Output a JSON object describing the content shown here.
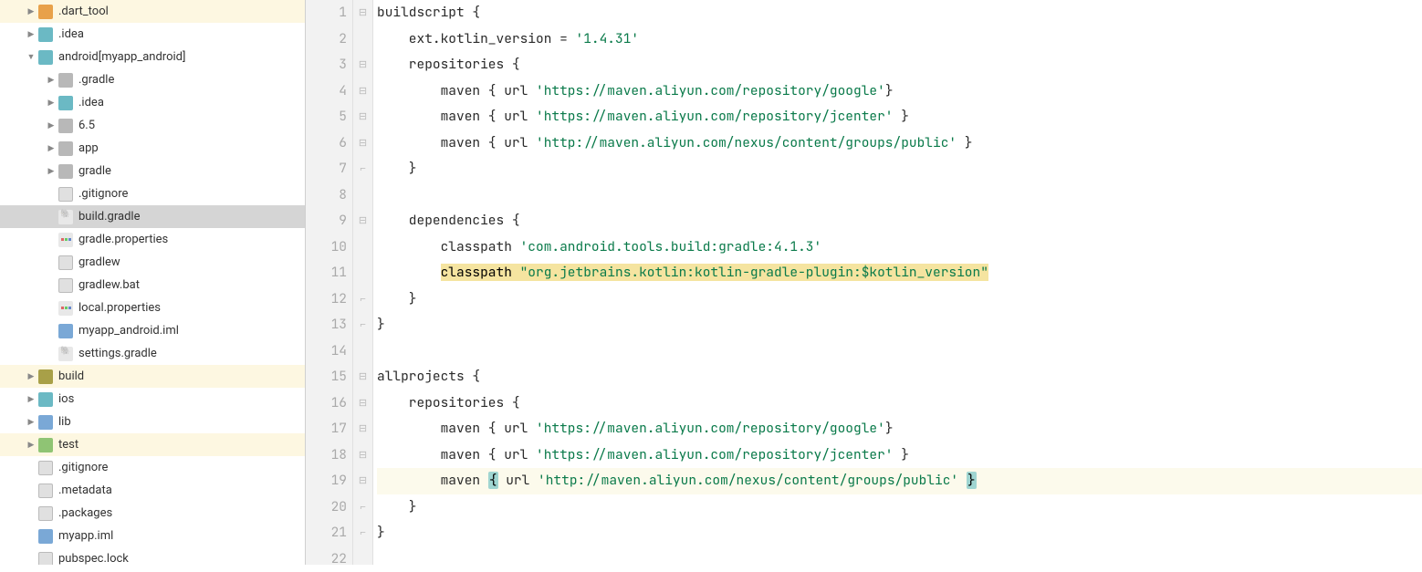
{
  "tree": {
    "items": [
      {
        "depth": 1,
        "arrow": "right",
        "icon": "folder-orange",
        "label": ".dart_tool",
        "hl": "yellow"
      },
      {
        "depth": 1,
        "arrow": "right",
        "icon": "folder-teal",
        "label": ".idea"
      },
      {
        "depth": 1,
        "arrow": "down",
        "icon": "folder-teal",
        "label": "android",
        "suffix": " [myapp_android]",
        "bold_suffix": true
      },
      {
        "depth": 2,
        "arrow": "right",
        "icon": "folder-gray",
        "label": ".gradle"
      },
      {
        "depth": 2,
        "arrow": "right",
        "icon": "folder-teal",
        "label": ".idea"
      },
      {
        "depth": 2,
        "arrow": "right",
        "icon": "folder-gray",
        "label": "6.5"
      },
      {
        "depth": 2,
        "arrow": "right",
        "icon": "folder-gray",
        "label": "app"
      },
      {
        "depth": 2,
        "arrow": "right",
        "icon": "folder-gray",
        "label": "gradle"
      },
      {
        "depth": 2,
        "arrow": "none",
        "icon": "file",
        "label": ".gitignore"
      },
      {
        "depth": 2,
        "arrow": "none",
        "icon": "gradle",
        "label": "build.gradle",
        "selected": true
      },
      {
        "depth": 2,
        "arrow": "none",
        "icon": "prop",
        "label": "gradle.properties"
      },
      {
        "depth": 2,
        "arrow": "none",
        "icon": "file",
        "label": "gradlew"
      },
      {
        "depth": 2,
        "arrow": "none",
        "icon": "file",
        "label": "gradlew.bat"
      },
      {
        "depth": 2,
        "arrow": "none",
        "icon": "prop",
        "label": "local.properties"
      },
      {
        "depth": 2,
        "arrow": "none",
        "icon": "iml",
        "label": "myapp_android.iml"
      },
      {
        "depth": 2,
        "arrow": "none",
        "icon": "gradle",
        "label": "settings.gradle"
      },
      {
        "depth": 1,
        "arrow": "right",
        "icon": "folder-olive",
        "label": "build",
        "hl": "yellow"
      },
      {
        "depth": 1,
        "arrow": "right",
        "icon": "folder-teal",
        "label": "ios"
      },
      {
        "depth": 1,
        "arrow": "right",
        "icon": "folder-blue",
        "label": "lib"
      },
      {
        "depth": 1,
        "arrow": "right",
        "icon": "folder-green",
        "label": "test",
        "hl": "yellow"
      },
      {
        "depth": 1,
        "arrow": "none",
        "icon": "file",
        "label": ".gitignore"
      },
      {
        "depth": 1,
        "arrow": "none",
        "icon": "file",
        "label": ".metadata"
      },
      {
        "depth": 1,
        "arrow": "none",
        "icon": "file",
        "label": ".packages"
      },
      {
        "depth": 1,
        "arrow": "none",
        "icon": "iml",
        "label": "myapp.iml"
      },
      {
        "depth": 1,
        "arrow": "none",
        "icon": "file",
        "label": "pubspec.lock"
      }
    ]
  },
  "code": {
    "lines": [
      {
        "n": 1,
        "fold": "open",
        "tokens": [
          {
            "t": "kw",
            "v": "buildscript "
          },
          {
            "t": "id",
            "v": "{"
          }
        ]
      },
      {
        "n": 2,
        "fold": "",
        "tokens": [
          {
            "t": "id",
            "v": "    ext.kotlin_version = "
          },
          {
            "t": "str",
            "v": "'1.4.31'"
          }
        ]
      },
      {
        "n": 3,
        "fold": "open",
        "tokens": [
          {
            "t": "id",
            "v": "    repositories {"
          }
        ]
      },
      {
        "n": 4,
        "fold": "open",
        "tokens": [
          {
            "t": "id",
            "v": "        maven { url "
          },
          {
            "t": "str",
            "v": "'https://maven.aliyun.com/repository/google'"
          },
          {
            "t": "id",
            "v": "}"
          }
        ]
      },
      {
        "n": 5,
        "fold": "open",
        "tokens": [
          {
            "t": "id",
            "v": "        maven { url "
          },
          {
            "t": "str",
            "v": "'https://maven.aliyun.com/repository/jcenter'"
          },
          {
            "t": "id",
            "v": " }"
          }
        ]
      },
      {
        "n": 6,
        "fold": "open",
        "tokens": [
          {
            "t": "id",
            "v": "        maven { url "
          },
          {
            "t": "str",
            "v": "'http://maven.aliyun.com/nexus/content/groups/public'"
          },
          {
            "t": "id",
            "v": " }"
          }
        ]
      },
      {
        "n": 7,
        "fold": "close",
        "tokens": [
          {
            "t": "id",
            "v": "    }"
          }
        ]
      },
      {
        "n": 8,
        "fold": "",
        "tokens": []
      },
      {
        "n": 9,
        "fold": "open",
        "tokens": [
          {
            "t": "id",
            "v": "    dependencies {"
          }
        ]
      },
      {
        "n": 10,
        "fold": "",
        "tokens": [
          {
            "t": "id",
            "v": "        classpath "
          },
          {
            "t": "str",
            "v": "'com.android.tools.build:gradle:4.1.3'"
          }
        ]
      },
      {
        "n": 11,
        "fold": "",
        "tokens": [
          {
            "t": "id",
            "v": "        "
          },
          {
            "t": "hl",
            "v": "classpath "
          },
          {
            "t": "hlstr",
            "v": "\"org.jetbrains.kotlin:kotlin-gradle-plugin:$kotlin_version\""
          }
        ]
      },
      {
        "n": 12,
        "fold": "close",
        "tokens": [
          {
            "t": "id",
            "v": "    }"
          }
        ]
      },
      {
        "n": 13,
        "fold": "close",
        "tokens": [
          {
            "t": "id",
            "v": "}"
          }
        ]
      },
      {
        "n": 14,
        "fold": "",
        "tokens": []
      },
      {
        "n": 15,
        "fold": "open",
        "tokens": [
          {
            "t": "kw",
            "v": "allprojects "
          },
          {
            "t": "id",
            "v": "{"
          }
        ]
      },
      {
        "n": 16,
        "fold": "open",
        "tokens": [
          {
            "t": "id",
            "v": "    repositories {"
          }
        ]
      },
      {
        "n": 17,
        "fold": "open",
        "tokens": [
          {
            "t": "id",
            "v": "        maven { url "
          },
          {
            "t": "str",
            "v": "'https://maven.aliyun.com/repository/google'"
          },
          {
            "t": "id",
            "v": "}"
          }
        ]
      },
      {
        "n": 18,
        "fold": "open",
        "tokens": [
          {
            "t": "id",
            "v": "        maven { url "
          },
          {
            "t": "str",
            "v": "'https://maven.aliyun.com/repository/jcenter'"
          },
          {
            "t": "id",
            "v": " }"
          }
        ]
      },
      {
        "n": 19,
        "fold": "open",
        "hl": true,
        "tokens": [
          {
            "t": "id",
            "v": "        maven "
          },
          {
            "t": "bm",
            "v": "{"
          },
          {
            "t": "id",
            "v": " url "
          },
          {
            "t": "str",
            "v": "'http://maven.aliyun.com/nexus/content/groups/public'"
          },
          {
            "t": "id",
            "v": " "
          },
          {
            "t": "bm",
            "v": "}"
          }
        ]
      },
      {
        "n": 20,
        "fold": "close",
        "tokens": [
          {
            "t": "id",
            "v": "    }"
          }
        ]
      },
      {
        "n": 21,
        "fold": "close",
        "tokens": [
          {
            "t": "id",
            "v": "}"
          }
        ]
      },
      {
        "n": 22,
        "fold": "",
        "tokens": []
      }
    ]
  }
}
